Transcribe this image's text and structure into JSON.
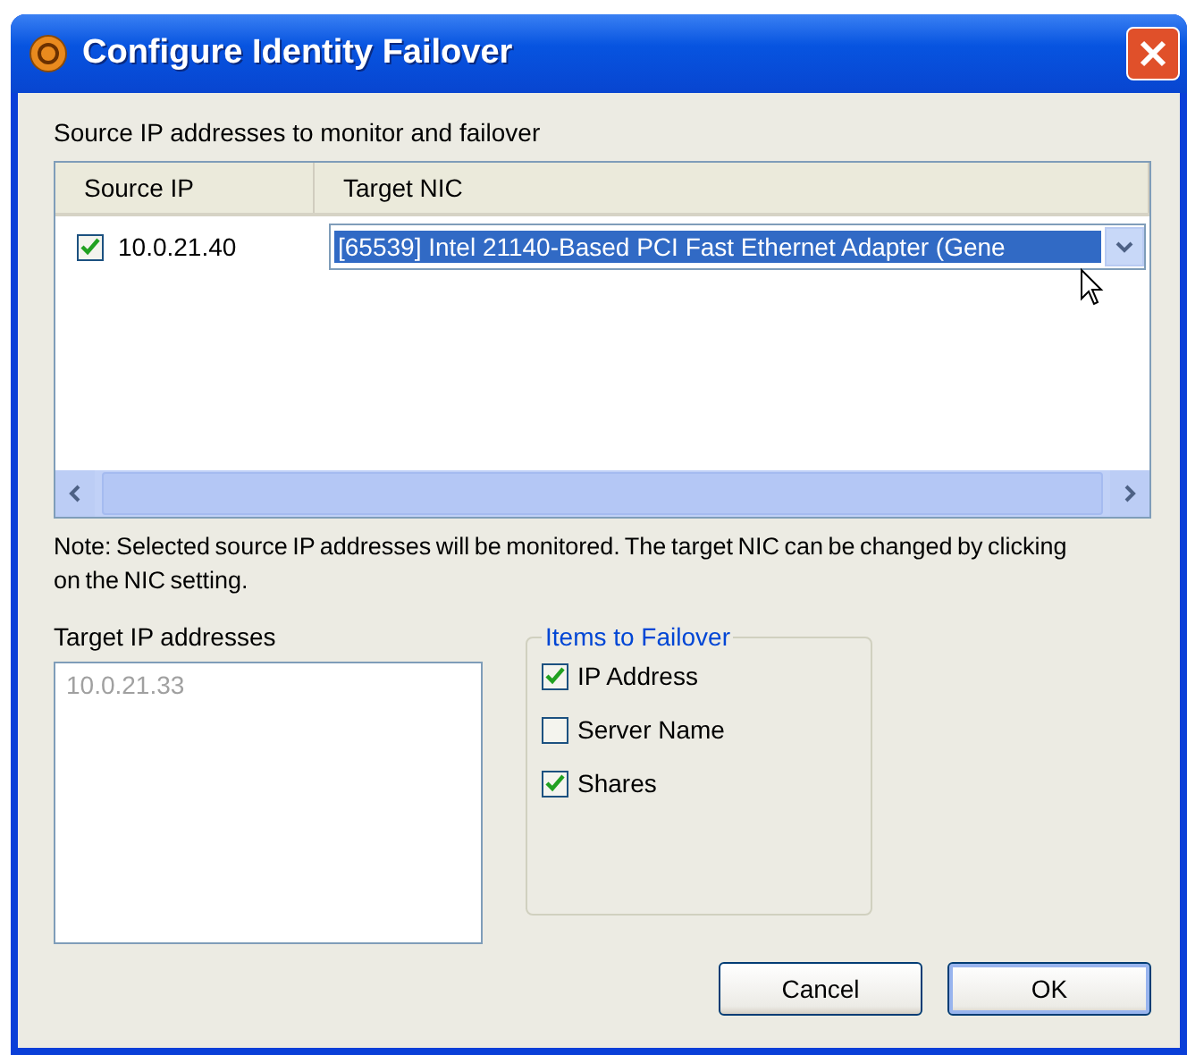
{
  "window": {
    "title": "Configure Identity Failover"
  },
  "source_label": "Source IP addresses to monitor and failover",
  "table": {
    "columns": [
      "Source IP",
      "Target NIC"
    ],
    "rows": [
      {
        "checked": true,
        "source_ip": "10.0.21.40",
        "target_nic": "[65539] Intel 21140-Based PCI Fast Ethernet Adapter (Gene",
        "selected": true
      }
    ]
  },
  "note": "Note:  Selected source IP addresses will be monitored.  The target NIC can be changed by clicking on the NIC setting.",
  "target_ip": {
    "label": "Target IP addresses",
    "disabled": true,
    "items": [
      "10.0.21.33"
    ]
  },
  "failover_group": {
    "title": "Items to Failover",
    "items": [
      {
        "label": "IP Address",
        "checked": true
      },
      {
        "label": "Server Name",
        "checked": false
      },
      {
        "label": "Shares",
        "checked": true
      }
    ]
  },
  "buttons": [
    {
      "label": "Cancel",
      "default": false
    },
    {
      "label": "OK",
      "default": true
    }
  ]
}
